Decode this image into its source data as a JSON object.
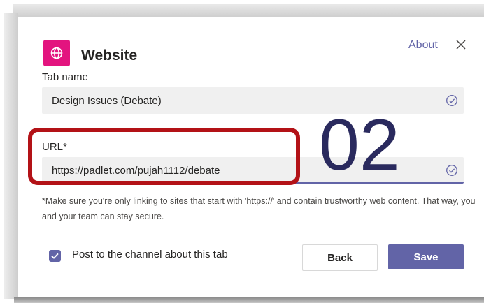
{
  "dialog": {
    "title": "Website",
    "about_label": "About",
    "app_icon": "globe-icon",
    "close_icon": "close-icon"
  },
  "tab_name": {
    "label": "Tab name",
    "value": "Design Issues (Debate)",
    "status_icon": "check-circle-icon"
  },
  "url": {
    "label": "URL*",
    "value": "https://padlet.com/pujah1112/debate",
    "status_icon": "check-circle-icon"
  },
  "note": "*Make sure you're only linking to sites that start with 'https://' and contain trustworthy web content. That way, you and your team can stay secure.",
  "post_to_channel": {
    "label": "Post to the channel about this tab",
    "checked": true
  },
  "buttons": {
    "back": "Back",
    "save": "Save"
  },
  "annotation": {
    "step_number": "02",
    "highlight_color": "#b31217"
  },
  "colors": {
    "accent": "#6264a7",
    "app_icon_bg": "#e3147f"
  }
}
